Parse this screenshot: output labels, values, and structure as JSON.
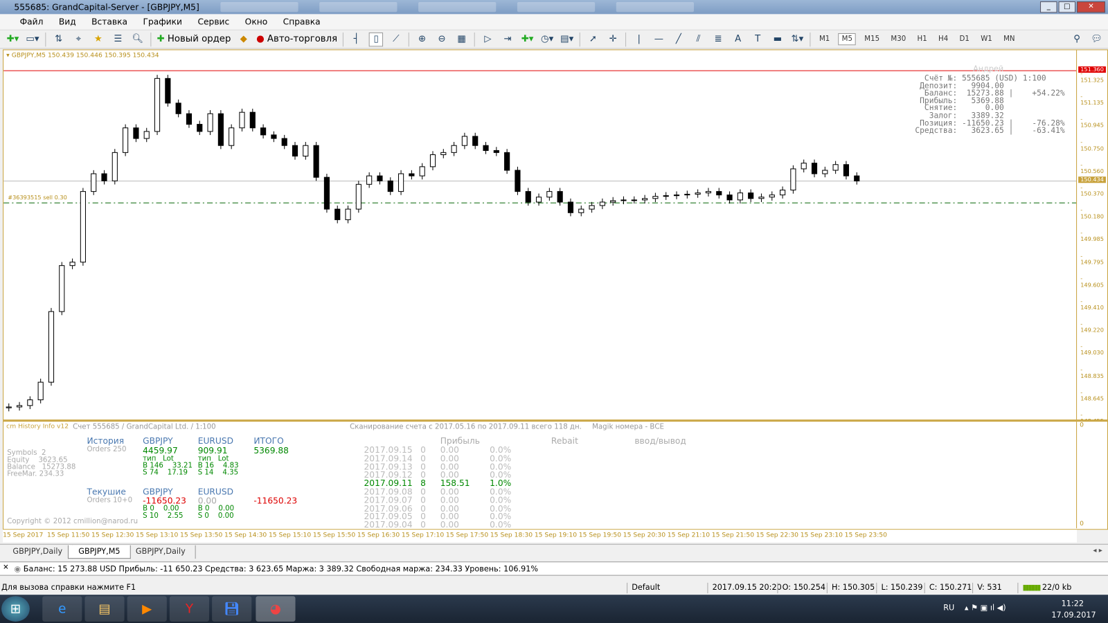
{
  "window": {
    "title": "555685: GrandCapital-Server - [GBPJPY,M5]"
  },
  "menu": [
    "Файл",
    "Вид",
    "Вставка",
    "Графики",
    "Сервис",
    "Окно",
    "Справка"
  ],
  "toolbar": {
    "new_order": "Новый ордер",
    "auto_trading": "Авто-торговля",
    "timeframes": [
      "M1",
      "M5",
      "M15",
      "M30",
      "H1",
      "H4",
      "D1",
      "W1",
      "MN"
    ],
    "active_timeframe": "M5"
  },
  "chart": {
    "header": "GBPJPY,M5  150.439 150.446 150.395 150.434",
    "order_label": "#36393515 sell 0.30",
    "watermark": "Андрей",
    "price_labels": [
      "151.325",
      "151.135",
      "150.945",
      "150.750",
      "150.560",
      "150.370",
      "150.180",
      "149.985",
      "149.795",
      "149.605",
      "149.410",
      "149.220",
      "149.030",
      "148.835",
      "148.645",
      "148.455"
    ],
    "red_line_price": "151.360",
    "bid_price": "150.434",
    "time_labels": [
      "15 Sep 2017",
      "15 Sep 11:50",
      "15 Sep 12:30",
      "15 Sep 13:10",
      "15 Sep 13:50",
      "15 Sep 14:30",
      "15 Sep 15:10",
      "15 Sep 15:50",
      "15 Sep 16:30",
      "15 Sep 17:10",
      "15 Sep 17:50",
      "15 Sep 18:30",
      "15 Sep 19:10",
      "15 Sep 19:50",
      "15 Sep 20:30",
      "15 Sep 21:10",
      "15 Sep 21:50",
      "15 Sep 22:30",
      "15 Sep 23:10",
      "15 Sep 23:50"
    ],
    "account": [
      {
        "k": "Счёт №:",
        "v": "555685 (USD) 1:100",
        "p": ""
      },
      {
        "k": "Депозит:",
        "v": "9904.00",
        "p": ""
      },
      {
        "k": "Баланс:",
        "v": "15273.88",
        "p": "+54.22%"
      },
      {
        "k": "Прибыль:",
        "v": "5369.88",
        "p": ""
      },
      {
        "k": "Снятие:",
        "v": "0.00",
        "p": ""
      },
      {
        "k": "Залог:",
        "v": "3389.32",
        "p": ""
      },
      {
        "k": "Позиция:",
        "v": "-11650.23",
        "p": "-76.28%"
      },
      {
        "k": "Средства:",
        "v": "3623.65",
        "p": "-63.41%"
      }
    ]
  },
  "chart_data": {
    "type": "candlestick",
    "symbol": "GBPJPY",
    "timeframe": "M5",
    "ylim": [
      148.455,
      151.325
    ],
    "open_first": 148.53,
    "closes": [
      148.537,
      148.549,
      148.597,
      148.745,
      149.338,
      149.724,
      149.753,
      150.346,
      150.495,
      150.435,
      150.673,
      150.88,
      150.791,
      150.85,
      151.295,
      151.088,
      150.999,
      150.91,
      150.85,
      150.999,
      150.732,
      150.88,
      151.011,
      150.88,
      150.821,
      150.791,
      150.732,
      150.643,
      150.732,
      150.465,
      150.198,
      150.109,
      150.198,
      150.406,
      150.477,
      150.435,
      150.346,
      150.495,
      150.477,
      150.554,
      150.655,
      150.673,
      150.732,
      150.809,
      150.732,
      150.69,
      150.673,
      150.524,
      150.346,
      150.257,
      150.299,
      150.346,
      150.257,
      150.168,
      150.198,
      150.228,
      150.257,
      150.269,
      150.275,
      150.275,
      150.287,
      150.305,
      150.311,
      150.317,
      150.323,
      150.334,
      150.346,
      150.317,
      150.275,
      150.334,
      150.287,
      150.299,
      150.317,
      150.358,
      150.536,
      150.584,
      150.495,
      150.524,
      150.572,
      150.477,
      150.434
    ],
    "sell_order_price": 150.25
  },
  "indicator": {
    "name": "cm History Info v12",
    "account": "Счет 555685 / GrandCapital Ltd. / 1:100",
    "scan": "Сканирование счета с 2017.05.16 по 2017.09.11 всего 118 дн.",
    "magic": "Magik номера - ВСЕ",
    "stats": [
      "Symbols  2",
      "Equity    3623.65",
      "Balance   15273.88",
      "FreeMar. 234.33"
    ],
    "history": {
      "label": "История",
      "orders": "Orders 250",
      "gbp": "GBPJPY",
      "gbp_val": "4459.97",
      "eur": "EURUSD",
      "eur_val": "909.91",
      "total": "ИТОГО",
      "total_val": "5369.88",
      "hdr": "тип   Lot",
      "gbp_b": "B 146    33.21",
      "gbp_s": "S 74    17.19",
      "eur_b": "B 16    4.83",
      "eur_s": "S 14    4.35"
    },
    "current": {
      "label": "Текушие",
      "orders": "Orders 10+0",
      "gbp": "GBPJPY",
      "gbp_val": "-11650.23",
      "eur": "EURUSD",
      "eur_val": "0.00",
      "total_val": "-11650.23",
      "gbp_b": "B 0    0.00",
      "gbp_s": "S 10    2.55",
      "eur_b": "B 0    0.00",
      "eur_s": "S 0    0.00"
    },
    "cols": {
      "profit": "Прибыль",
      "rebait": "Rebait",
      "io": "ввод/вывод"
    },
    "days": [
      [
        "2017.09.15",
        "0",
        "0.00",
        "0.0%"
      ],
      [
        "2017.09.14",
        "0",
        "0.00",
        "0.0%"
      ],
      [
        "2017.09.13",
        "0",
        "0.00",
        "0.0%"
      ],
      [
        "2017.09.12",
        "0",
        "0.00",
        "0.0%"
      ],
      [
        "2017.09.11",
        "8",
        "158.51",
        "1.0%"
      ],
      [
        "2017.09.08",
        "0",
        "0.00",
        "0.0%"
      ],
      [
        "2017.09.07",
        "0",
        "0.00",
        "0.0%"
      ],
      [
        "2017.09.06",
        "0",
        "0.00",
        "0.0%"
      ],
      [
        "2017.09.05",
        "0",
        "0.00",
        "0.0%"
      ],
      [
        "2017.09.04",
        "0",
        "0.00",
        "0.0%"
      ]
    ],
    "copyright": "Copyright © 2012 cmillion@narod.ru",
    "axis_top": "0",
    "axis_bottom": "0"
  },
  "tabs": [
    "GBPJPY,Daily",
    "GBPJPY,M5",
    "GBPJPY,Daily"
  ],
  "terminal": "Баланс: 15 273.88 USD  Прибыль: -11 650.23  Средства: 3 623.65  Маржа: 3 389.32  Свободная маржа: 234.33  Уровень: 106.91%",
  "status": {
    "help": "Для вызова справки нажмите F1",
    "profile": "Default",
    "time": "2017.09.15 20:20",
    "o": "O: 150.254",
    "h": "H: 150.305",
    "l": "L: 150.239",
    "c": "C: 150.271",
    "v": "V: 531",
    "traffic": "22/0 kb"
  },
  "taskbar": {
    "lang": "RU",
    "clock": "11:22",
    "date": "17.09.2017"
  },
  "colors": {
    "up": "#ffffff",
    "down": "#000000",
    "red_line": "#e00000",
    "order_line": "#006400",
    "axis": "#b8901c"
  }
}
